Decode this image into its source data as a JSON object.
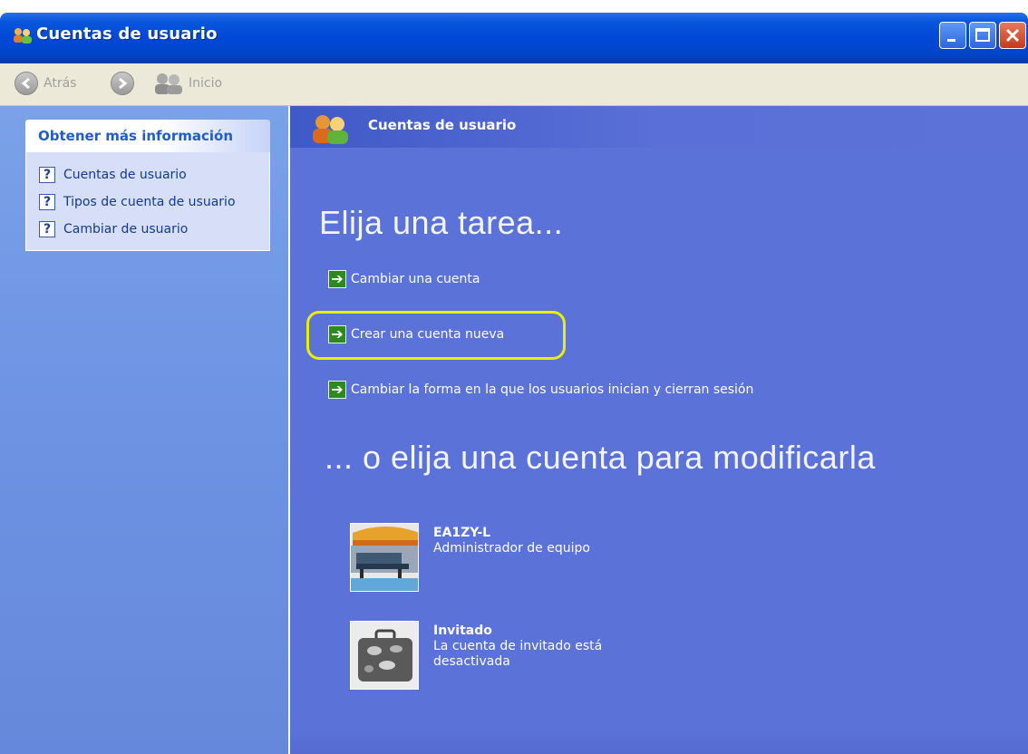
{
  "window": {
    "title": "Cuentas de usuario"
  },
  "toolbar": {
    "back_label": "Atrás",
    "home_label": "Inicio"
  },
  "sidebar": {
    "panel_title": "Obtener más información",
    "items": [
      {
        "label": "Cuentas de usuario",
        "icon": "help-icon"
      },
      {
        "label": "Tipos de cuenta de usuario",
        "icon": "help-icon"
      },
      {
        "label": "Cambiar de usuario",
        "icon": "help-icon"
      }
    ]
  },
  "main": {
    "header_title": "Cuentas de usuario",
    "task_heading": "Elija una tarea...",
    "tasks": [
      {
        "label": "Cambiar una cuenta"
      },
      {
        "label": "Crear una cuenta nueva",
        "highlighted": true
      },
      {
        "label": "Cambiar la forma en la que los usuarios inician y cierran sesión"
      }
    ],
    "account_heading": "... o elija una cuenta para modificarla",
    "accounts": [
      {
        "name": "EA1ZY-L",
        "description": "Administrador de equipo",
        "picture": "beach-chair"
      },
      {
        "name": "Invitado",
        "description": "La cuenta de invitado está desactivada",
        "picture": "suitcase"
      }
    ]
  },
  "colors": {
    "titlebar": "#0048d8",
    "sidebar": "#7aa2e8",
    "main_background": "#5b72d8",
    "highlight": "#e8f000",
    "task_arrow": "#2c8a1e"
  }
}
